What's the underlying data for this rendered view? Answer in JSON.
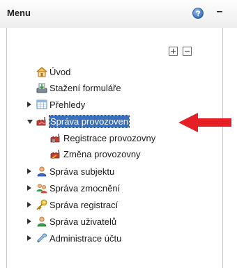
{
  "header": {
    "title": "Menu",
    "help_icon": "help-icon",
    "minimize_label": "–"
  },
  "toolbar": {
    "expand_all_icon": "plus-square-icon",
    "collapse_all_icon": "minus-square-icon"
  },
  "tree": {
    "items": [
      {
        "label": "Úvod",
        "icon": "home-icon"
      },
      {
        "label": "Stažení formuláře",
        "icon": "download-form-icon"
      },
      {
        "label": "Přehledy",
        "icon": "table-icon",
        "state": "collapsed"
      },
      {
        "label": "Správa provozoven",
        "icon": "factory-icon",
        "state": "expanded",
        "selected": true,
        "children": [
          {
            "label": "Registrace provozovny",
            "icon": "factory-gear-icon"
          },
          {
            "label": "Změna provozovny",
            "icon": "factory-edit-icon"
          }
        ]
      },
      {
        "label": "Správa subjektu",
        "icon": "person-icon",
        "state": "collapsed"
      },
      {
        "label": "Správa zmocnění",
        "icon": "people-icon",
        "state": "collapsed"
      },
      {
        "label": "Správa registrací",
        "icon": "key-icon",
        "state": "collapsed"
      },
      {
        "label": "Správa uživatelů",
        "icon": "user-green-icon",
        "state": "collapsed"
      },
      {
        "label": "Administrace účtu",
        "icon": "wrench-icon",
        "state": "collapsed"
      }
    ]
  },
  "colors": {
    "selection": "#3a6fbd",
    "pointer_arrow": "#e41f26"
  }
}
